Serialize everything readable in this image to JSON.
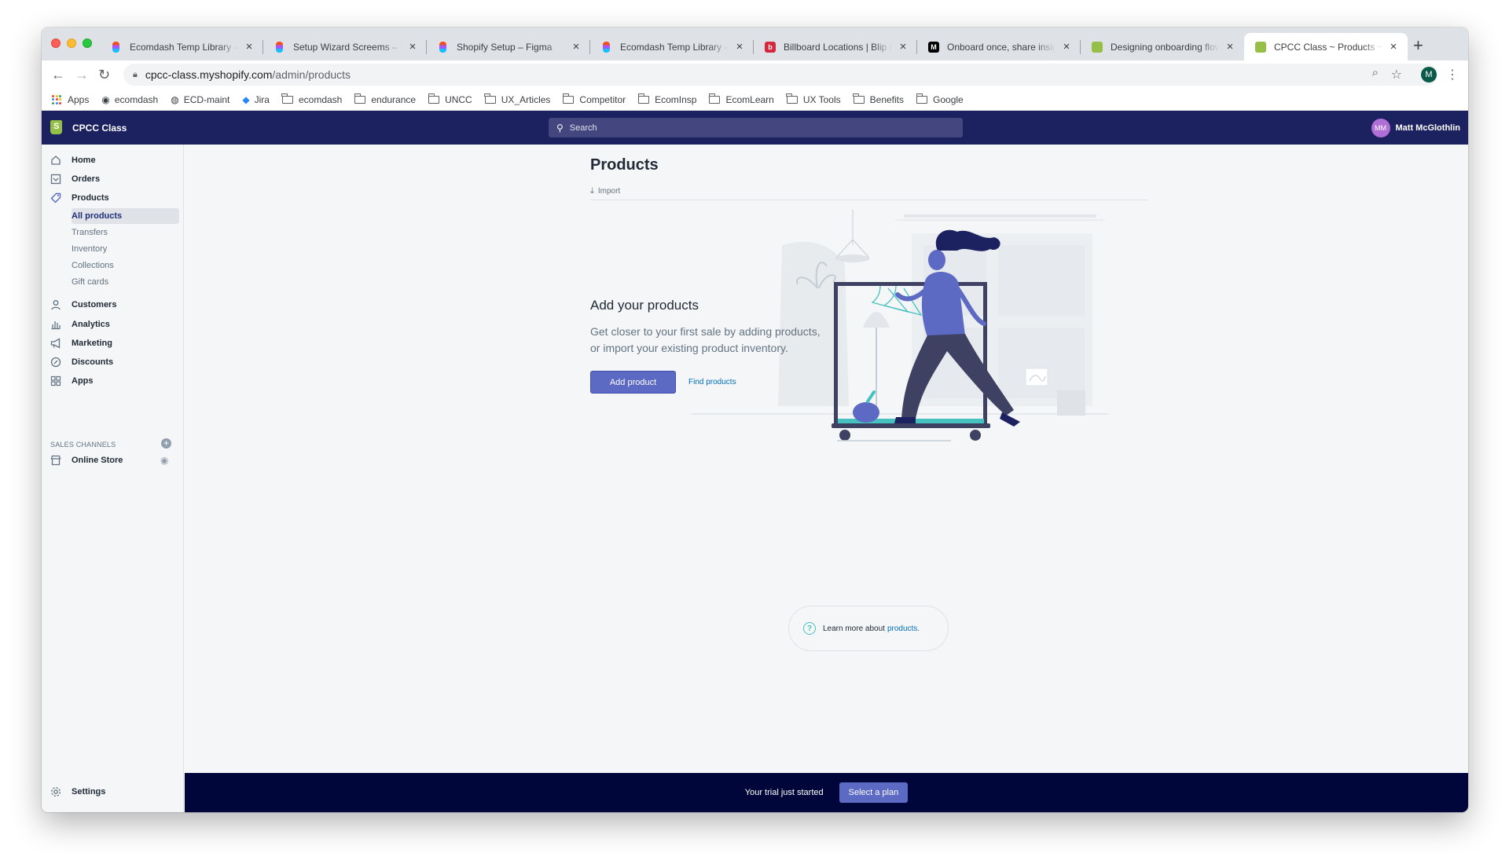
{
  "browser": {
    "tabs": [
      {
        "title": "Ecomdash Temp Library – F",
        "favicon": "figma"
      },
      {
        "title": "Setup Wizard Screems – Fi",
        "favicon": "figma"
      },
      {
        "title": "Shopify Setup – Figma",
        "favicon": "figma"
      },
      {
        "title": "Ecomdash Temp Library – F",
        "favicon": "figma"
      },
      {
        "title": "Billboard Locations | Blip Bi",
        "favicon": "blip"
      },
      {
        "title": "Onboard once, share insigh",
        "favicon": "medium"
      },
      {
        "title": "Designing onboarding flow",
        "favicon": "shopify"
      },
      {
        "title": "CPCC Class ~ Products ~ S",
        "favicon": "shopify"
      }
    ],
    "new_tab": "+",
    "url_host": "cpcc-class.myshopify.com",
    "url_path": "/admin/products",
    "profile_initial": "M",
    "bookmarks": [
      {
        "label": "Apps",
        "icon": "apps-grid-icon"
      },
      {
        "label": "ecomdash",
        "icon": "ecomdash-icon"
      },
      {
        "label": "ECD-maint",
        "icon": "globe-icon"
      },
      {
        "label": "Jira",
        "icon": "jira-icon"
      },
      {
        "label": "ecomdash",
        "icon": "folder-icon"
      },
      {
        "label": "endurance",
        "icon": "folder-icon"
      },
      {
        "label": "UNCC",
        "icon": "folder-icon"
      },
      {
        "label": "UX_Articles",
        "icon": "folder-icon"
      },
      {
        "label": "Competitor",
        "icon": "folder-icon"
      },
      {
        "label": "EcomInsp",
        "icon": "folder-icon"
      },
      {
        "label": "EcomLearn",
        "icon": "folder-icon"
      },
      {
        "label": "UX Tools",
        "icon": "folder-icon"
      },
      {
        "label": "Benefits",
        "icon": "folder-icon"
      },
      {
        "label": "Google",
        "icon": "folder-icon"
      }
    ]
  },
  "shopify": {
    "store_name": "CPCC Class",
    "search_placeholder": "Search",
    "user_initials": "MM",
    "user_name": "Matt McGlothlin",
    "sidebar": {
      "items": [
        {
          "label": "Home",
          "icon": "home-icon"
        },
        {
          "label": "Orders",
          "icon": "orders-icon"
        },
        {
          "label": "Products",
          "icon": "tag-icon"
        },
        {
          "label": "Customers",
          "icon": "person-icon"
        },
        {
          "label": "Analytics",
          "icon": "bar-chart-icon"
        },
        {
          "label": "Marketing",
          "icon": "megaphone-icon"
        },
        {
          "label": "Discounts",
          "icon": "discount-icon"
        },
        {
          "label": "Apps",
          "icon": "apps-icon"
        }
      ],
      "product_subitems": [
        "All products",
        "Transfers",
        "Inventory",
        "Collections",
        "Gift cards"
      ],
      "active_subitem": "All products",
      "sales_channels_label": "SALES CHANNELS",
      "online_store": "Online Store",
      "settings": "Settings"
    },
    "page": {
      "title": "Products",
      "import_label": "Import",
      "empty_heading": "Add your products",
      "empty_body": "Get closer to your first sale by adding products, or import your existing product inventory.",
      "add_product": "Add product",
      "find_products": "Find products",
      "learn_prefix": "Learn more about",
      "learn_link": "products."
    },
    "trial": {
      "text": "Your trial just started",
      "button": "Select a plan"
    }
  },
  "colors": {
    "topbar": "#1c2260",
    "primary": "#5c6ac4",
    "trial_bar": "#000639",
    "link": "#006fbb"
  }
}
